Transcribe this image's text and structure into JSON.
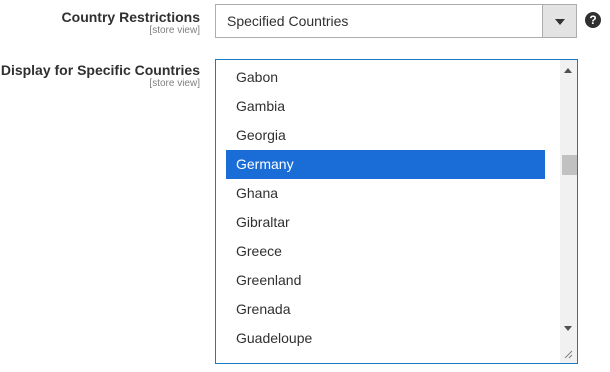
{
  "country_restrictions": {
    "label": "Country Restrictions",
    "scope": "[store view]",
    "selected_value": "Specified Countries"
  },
  "help": {
    "glyph": "?"
  },
  "specific_countries": {
    "label": "Display for Specific Countries",
    "scope": "[store view]",
    "options": [
      {
        "label": "Gabon",
        "selected": false
      },
      {
        "label": "Gambia",
        "selected": false
      },
      {
        "label": "Georgia",
        "selected": false
      },
      {
        "label": "Germany",
        "selected": true
      },
      {
        "label": "Ghana",
        "selected": false
      },
      {
        "label": "Gibraltar",
        "selected": false
      },
      {
        "label": "Greece",
        "selected": false
      },
      {
        "label": "Greenland",
        "selected": false
      },
      {
        "label": "Grenada",
        "selected": false
      },
      {
        "label": "Guadeloupe",
        "selected": false
      }
    ]
  },
  "colors": {
    "selected_bg": "#1a6dd6",
    "focus_border": "#1979c3"
  }
}
